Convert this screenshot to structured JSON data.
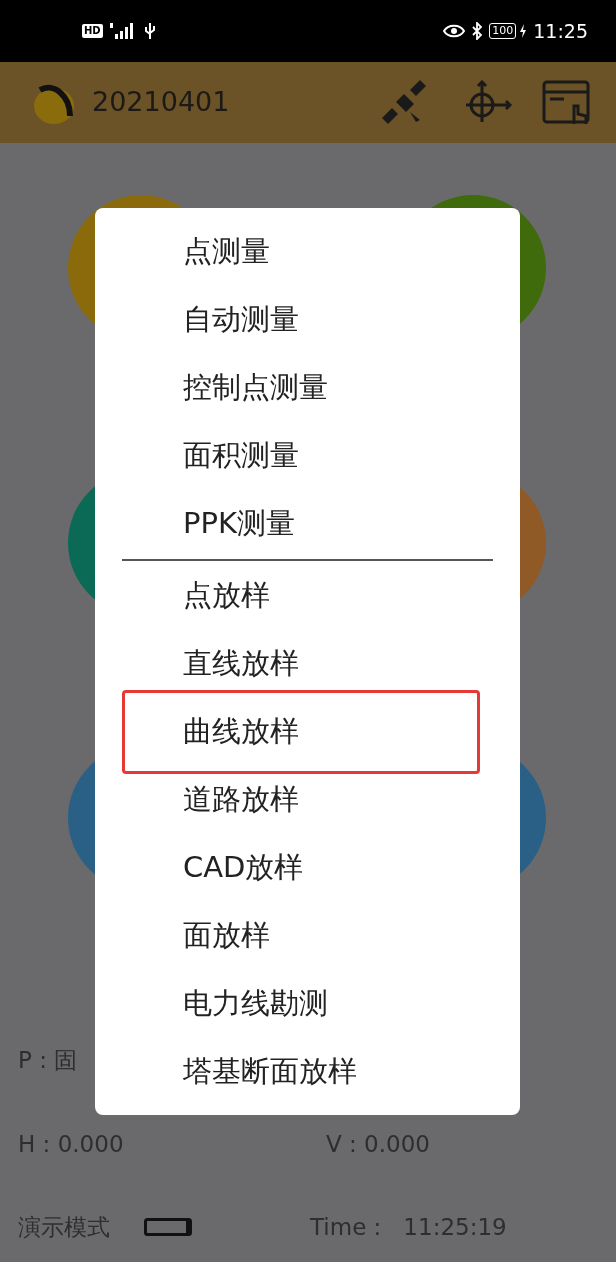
{
  "status_bar": {
    "network_badge": "HD",
    "battery": "100",
    "time": "11:25"
  },
  "header": {
    "title": "20210401"
  },
  "tiles": [
    {
      "color": "#8a6a0a"
    },
    {
      "color": "#3f6b0c"
    },
    {
      "color": "#0b6a55"
    },
    {
      "color": "#8f5a25"
    },
    {
      "color": "#2a5f86"
    },
    {
      "color": "#2a5f86"
    }
  ],
  "info": {
    "p": "P : 固",
    "h": "H : 0.000",
    "v": "V : 0.000",
    "mode": "演示模式",
    "time_label": "Time :",
    "time": "11:25:19"
  },
  "menu": {
    "items": [
      {
        "label": "点测量",
        "highlighted": false,
        "divider_after": false
      },
      {
        "label": "自动测量",
        "highlighted": false,
        "divider_after": false
      },
      {
        "label": "控制点测量",
        "highlighted": false,
        "divider_after": false
      },
      {
        "label": "面积测量",
        "highlighted": false,
        "divider_after": false
      },
      {
        "label": "PPK测量",
        "highlighted": false,
        "divider_after": true
      },
      {
        "label": "点放样",
        "highlighted": false,
        "divider_after": false
      },
      {
        "label": "直线放样",
        "highlighted": false,
        "divider_after": false
      },
      {
        "label": "曲线放样",
        "highlighted": true,
        "divider_after": false
      },
      {
        "label": "道路放样",
        "highlighted": false,
        "divider_after": false
      },
      {
        "label": "CAD放样",
        "highlighted": false,
        "divider_after": false
      },
      {
        "label": "面放样",
        "highlighted": false,
        "divider_after": false
      },
      {
        "label": "电力线勘测",
        "highlighted": false,
        "divider_after": false
      },
      {
        "label": "塔基断面放样",
        "highlighted": false,
        "divider_after": false
      }
    ]
  }
}
